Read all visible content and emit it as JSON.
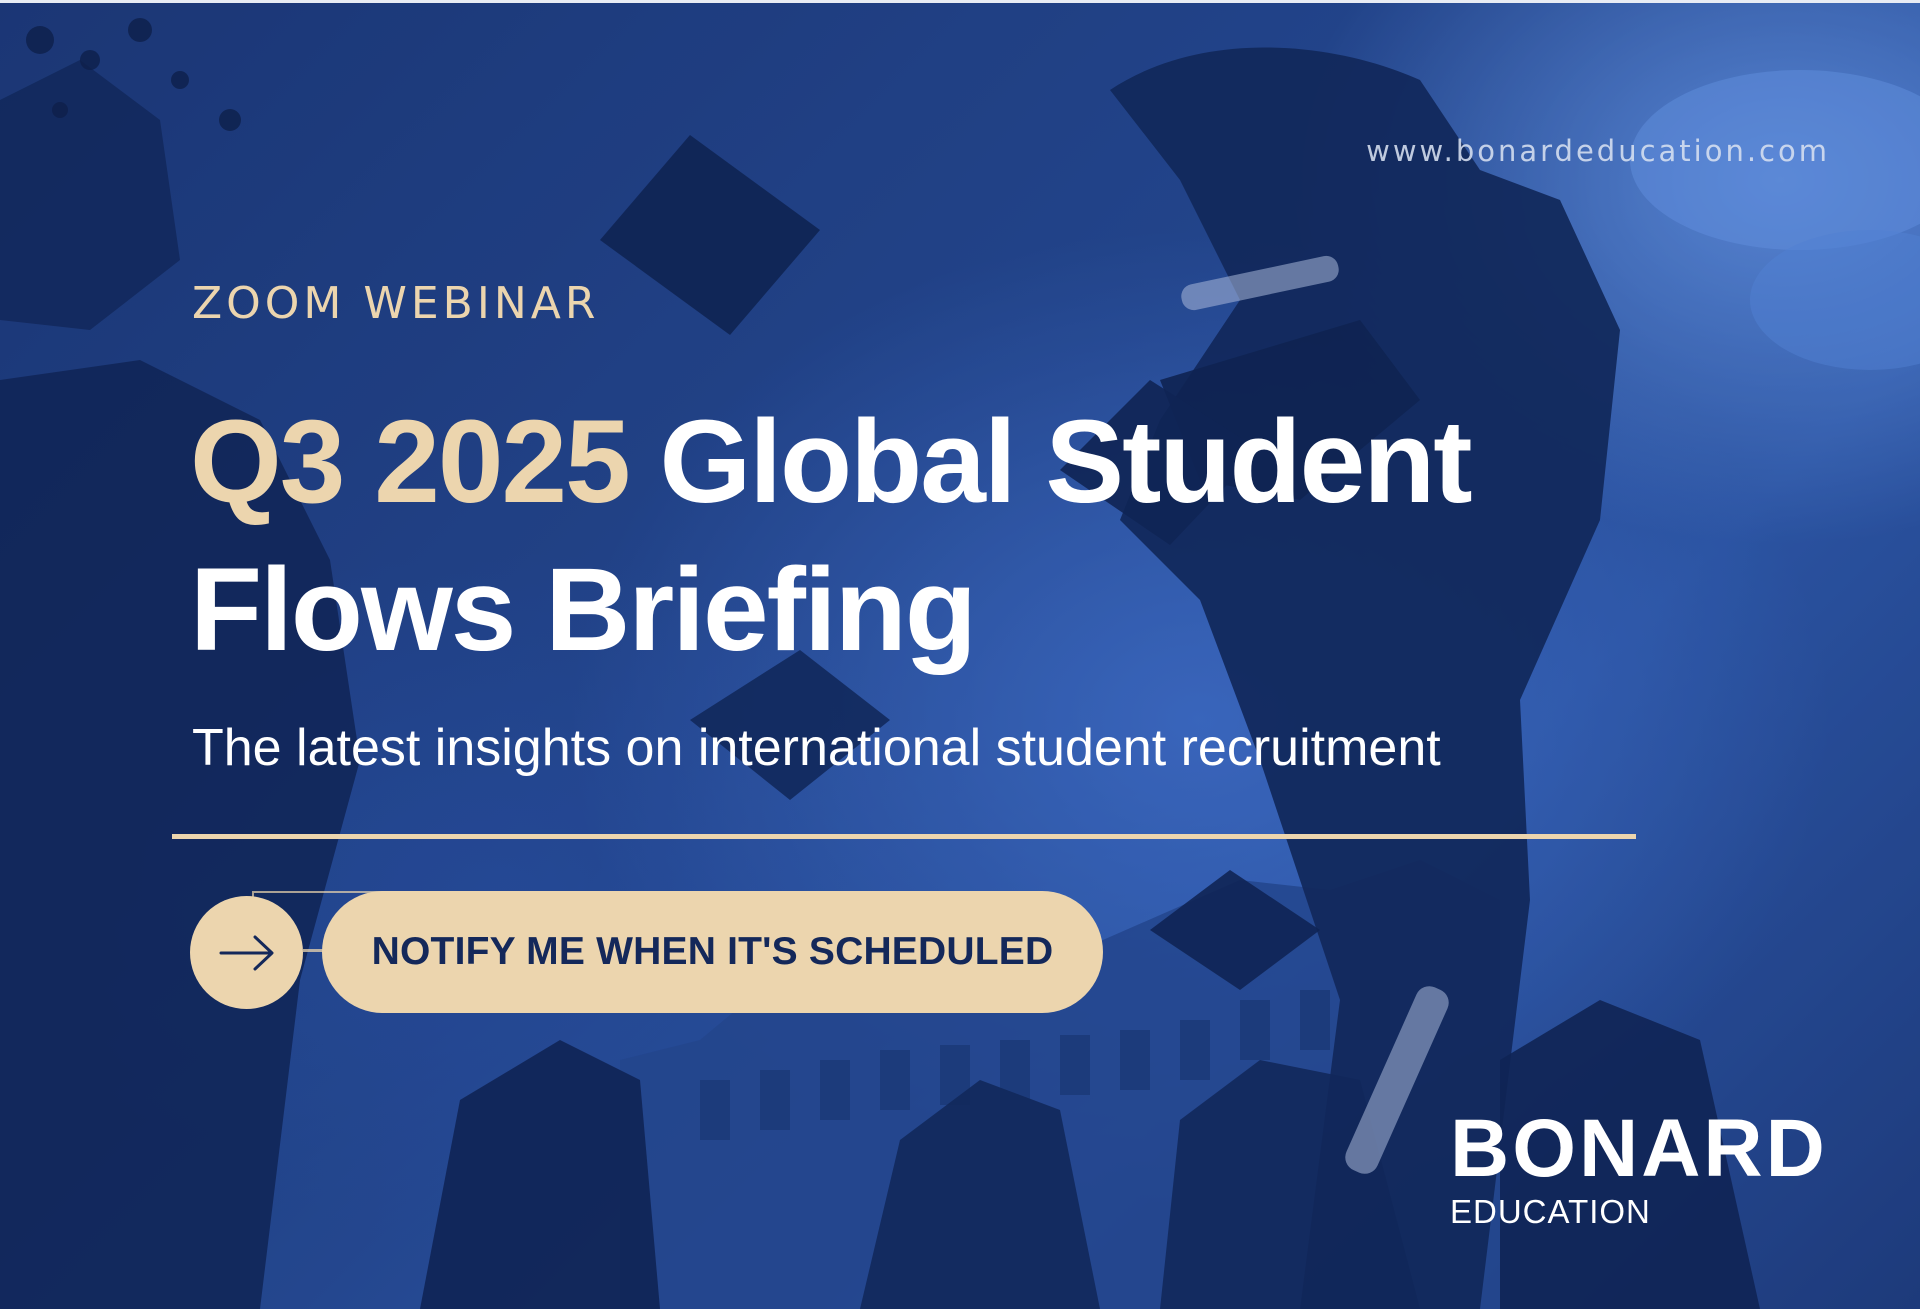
{
  "banner": {
    "website": "www.bonardeducation.com",
    "eyebrow": "ZOOM WEBINAR",
    "headline_accent": "Q3 2025",
    "headline_rest": " Global Student Flows Briefing",
    "subtitle": "The latest insights on international student recruitment",
    "cta_label": "NOTIFY ME WHEN IT'S SCHEDULED",
    "cta_icon": "arrow-right-icon"
  },
  "logo": {
    "wordmark": "BONARD",
    "subline": "EDUCATION"
  },
  "colors": {
    "accent": "#ecd5ae",
    "navy": "#14285a",
    "text": "#ffffff",
    "background": "#1f3f82"
  }
}
